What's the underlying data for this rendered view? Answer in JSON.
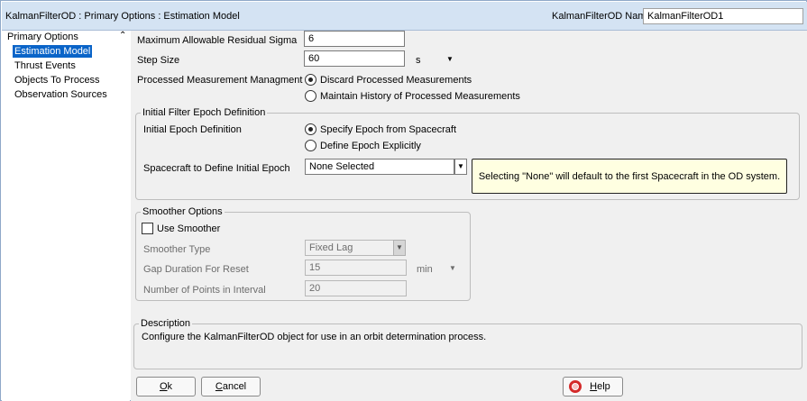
{
  "window": {
    "title": "KalmanFilterOD : Primary Options : Estimation Model",
    "name_label": "KalmanFilterOD Name",
    "name_value": "KalmanFilterOD1"
  },
  "sidebar": {
    "root": "Primary Options",
    "collapse_glyph": "⌃",
    "items": [
      {
        "label": "Estimation Model",
        "selected": true
      },
      {
        "label": "Thrust Events"
      },
      {
        "label": "Objects To Process"
      },
      {
        "label": "Observation Sources"
      }
    ]
  },
  "fields": {
    "max_residual": {
      "label": "Maximum Allowable Residual Sigma",
      "value": "6"
    },
    "step_size": {
      "label": "Step Size",
      "value": "60",
      "unit": "s"
    },
    "processed": {
      "label": "Processed Measurement Managment",
      "options": [
        "Discard Processed Measurements",
        "Maintain History of Processed Measurements"
      ],
      "selected": 0
    }
  },
  "initial_epoch": {
    "group_title": "Initial Filter Epoch Definition",
    "def_label": "Initial Epoch Definition",
    "options": [
      "Specify Epoch from Spacecraft",
      "Define Epoch Explicitly"
    ],
    "selected": 0,
    "spacecraft_label": "Spacecraft to Define Initial Epoch",
    "spacecraft_value": "None Selected",
    "note": "Selecting \"None\" will default to the first Spacecraft in the OD system."
  },
  "smoother": {
    "group_title": "Smoother Options",
    "use_label": "Use Smoother",
    "use_checked": false,
    "type_label": "Smoother Type",
    "type_value": "Fixed Lag",
    "gap_label": "Gap Duration For Reset",
    "gap_value": "15",
    "gap_unit": "min",
    "points_label": "Number of Points in Interval",
    "points_value": "20"
  },
  "description": {
    "title": "Description",
    "text": "Configure the KalmanFilterOD object for use in an orbit determination process."
  },
  "buttons": {
    "ok_prefix": "",
    "ok_mnemonic": "O",
    "ok_rest": "k",
    "cancel_mnemonic": "C",
    "cancel_rest": "ancel",
    "help_mnemonic": "H",
    "help_rest": "elp"
  },
  "colors": {
    "selection": "#0a64c8",
    "titlebar": "#d4e3f3",
    "note_bg": "#ffffe1",
    "help_icon": "#d42a2a"
  }
}
